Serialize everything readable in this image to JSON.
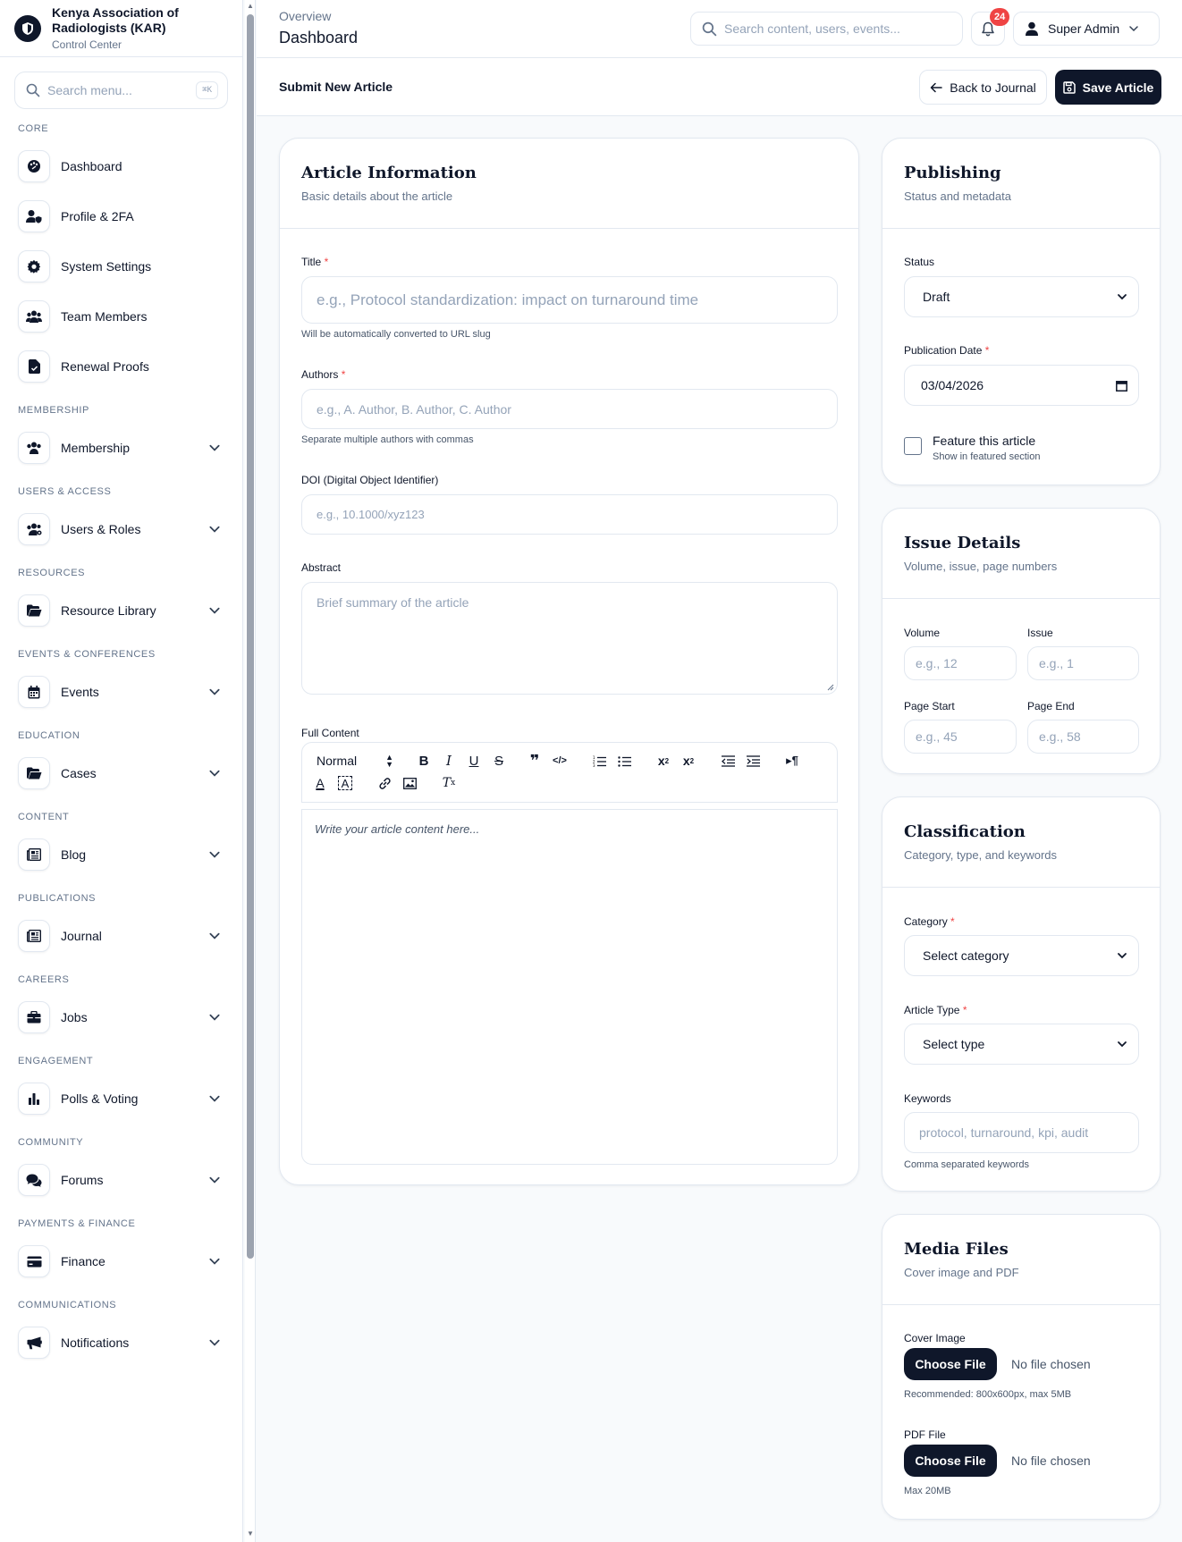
{
  "brand": {
    "name_line1": "Kenya Association of",
    "name_line2": "Radiologists (KAR)",
    "subtitle": "Control Center"
  },
  "menu_search": {
    "placeholder": "Search menu...",
    "shortcut": "⌘K"
  },
  "nav": {
    "core_label": "CORE",
    "core_items": [
      "Dashboard",
      "Profile & 2FA",
      "System Settings",
      "Team Members",
      "Renewal Proofs"
    ],
    "groups": [
      {
        "label": "MEMBERSHIP",
        "item": "Membership",
        "icon": "users-icon"
      },
      {
        "label": "USERS & ACCESS",
        "item": "Users & Roles",
        "icon": "users-cog-icon"
      },
      {
        "label": "RESOURCES",
        "item": "Resource Library",
        "icon": "folder-open-icon"
      },
      {
        "label": "EVENTS & CONFERENCES",
        "item": "Events",
        "icon": "calendar-icon"
      },
      {
        "label": "EDUCATION",
        "item": "Cases",
        "icon": "folder-open-icon"
      },
      {
        "label": "CONTENT",
        "item": "Blog",
        "icon": "newspaper-icon"
      },
      {
        "label": "PUBLICATIONS",
        "item": "Journal",
        "icon": "newspaper-icon"
      },
      {
        "label": "CAREERS",
        "item": "Jobs",
        "icon": "briefcase-icon"
      },
      {
        "label": "ENGAGEMENT",
        "item": "Polls & Voting",
        "icon": "chart-bar-icon"
      },
      {
        "label": "COMMUNITY",
        "item": "Forums",
        "icon": "comments-icon"
      },
      {
        "label": "PAYMENTS & FINANCE",
        "item": "Finance",
        "icon": "credit-card-icon"
      },
      {
        "label": "COMMUNICATIONS",
        "item": "Notifications",
        "icon": "megaphone-icon"
      }
    ]
  },
  "topbar": {
    "breadcrumb": "Overview",
    "title": "Dashboard",
    "search_placeholder": "Search content, users, events...",
    "notification_count": "24",
    "user_name": "Super Admin"
  },
  "subheader": {
    "title": "Submit New Article",
    "back_label": "Back to Journal",
    "save_label": "Save Article"
  },
  "article_info": {
    "title": "Article Information",
    "subtitle": "Basic details about the article",
    "title_label": "Title",
    "title_placeholder": "e.g., Protocol standardization: impact on turnaround time",
    "title_hint": "Will be automatically converted to URL slug",
    "authors_label": "Authors",
    "authors_placeholder": "e.g., A. Author, B. Author, C. Author",
    "authors_hint": "Separate multiple authors with commas",
    "doi_label": "DOI (Digital Object Identifier)",
    "doi_placeholder": "e.g., 10.1000/xyz123",
    "abstract_label": "Abstract",
    "abstract_placeholder": "Brief summary of the article",
    "content_label": "Full Content",
    "editor_format": "Normal",
    "editor_placeholder": "Write your article content here..."
  },
  "publishing": {
    "title": "Publishing",
    "subtitle": "Status and metadata",
    "status_label": "Status",
    "status_value": "Draft",
    "date_label": "Publication Date",
    "date_value": "03/04/2026",
    "feature_label": "Feature this article",
    "feature_hint": "Show in featured section"
  },
  "issue": {
    "title": "Issue Details",
    "subtitle": "Volume, issue, page numbers",
    "volume_label": "Volume",
    "volume_placeholder": "e.g., 12",
    "issue_label": "Issue",
    "issue_placeholder": "e.g., 1",
    "page_start_label": "Page Start",
    "page_start_placeholder": "e.g., 45",
    "page_end_label": "Page End",
    "page_end_placeholder": "e.g., 58"
  },
  "classification": {
    "title": "Classification",
    "subtitle": "Category, type, and keywords",
    "category_label": "Category",
    "category_value": "Select category",
    "type_label": "Article Type",
    "type_value": "Select type",
    "keywords_label": "Keywords",
    "keywords_placeholder": "protocol, turnaround, kpi, audit",
    "keywords_hint": "Comma separated keywords"
  },
  "media": {
    "title": "Media Files",
    "subtitle": "Cover image and PDF",
    "cover_label": "Cover Image",
    "choose_label": "Choose File",
    "no_file": "No file chosen",
    "cover_hint": "Recommended: 800x600px, max 5MB",
    "pdf_label": "PDF File",
    "pdf_hint": "Max 20MB"
  },
  "colors": {
    "primary": "#0f172a",
    "border": "#e2e8f0",
    "muted": "#64748b",
    "danger": "#ef4444"
  }
}
